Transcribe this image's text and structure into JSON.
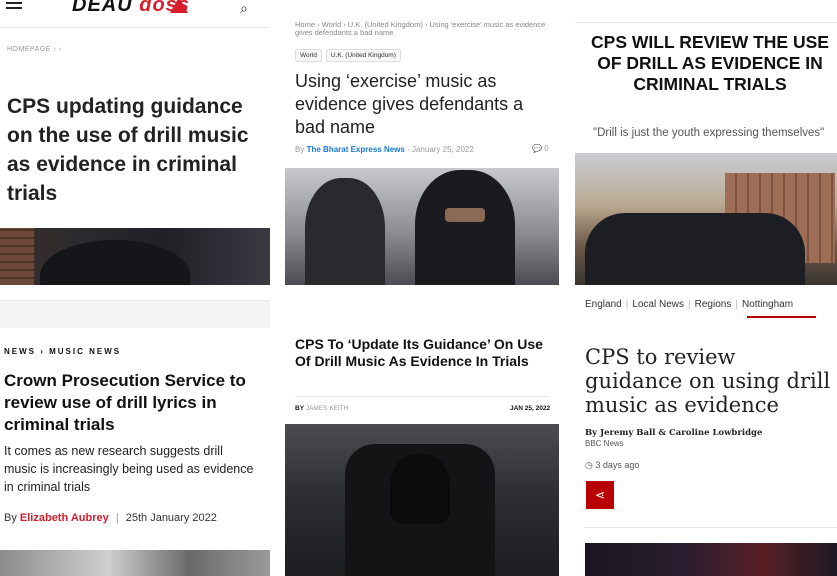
{
  "panel1": {
    "logo_part1": "DEAU",
    "logo_part2": "doss",
    "breadcrumb": "HOMEPAGE  ›  ›",
    "title": "CPS updating guidance on the use of drill music as evidence in criminal trials",
    "section_label": "NEWS › MUSIC NEWS",
    "headline": "Crown Prosecution Service to review use of drill lyrics in criminal trials",
    "subheading": "It comes as new research suggests drill music is increasingly being used as evidence in criminal trials",
    "byline_prefix": "By",
    "author": "Elizabeth Aubrey",
    "date": "25th January 2022",
    "colors": {
      "accent": "#d81e2c"
    }
  },
  "panel2": {
    "breadcrumb": "Home › World › U.K. (United Kingdom) › Using 'exercise' music as evidence gives defendants a bad name",
    "tags": [
      "World",
      "U.K. (United Kingdom)"
    ],
    "title": "Using ‘exercise’ music as evidence gives defendants a bad name",
    "by_label": "By",
    "source": "The Bharat Express News",
    "date": "- January 25, 2022",
    "comments": "0",
    "title2": "CPS To ‘Update Its Guidance’ On Use Of Drill Music As Evidence In Trials",
    "by2_label": "BY",
    "author2": "JAMES KEITH",
    "date2": "JAN 25, 2022",
    "colors": {
      "link": "#1976d2"
    }
  },
  "panel3": {
    "title": "CPS WILL REVIEW THE USE OF DRILL AS EVIDENCE IN CRIMINAL TRIALS",
    "quote": "\"Drill is just the youth expressing themselves\"",
    "nav": [
      "England",
      "Local News",
      "Regions",
      "Nottingham"
    ],
    "active_nav": "Nottingham",
    "headline": "CPS to review guidance on using drill music as evidence",
    "authors": "By Jeremy Ball & Caroline Lowbridge",
    "org": "BBC News",
    "time": "3 days ago",
    "colors": {
      "bbc_red": "#b80000"
    }
  }
}
